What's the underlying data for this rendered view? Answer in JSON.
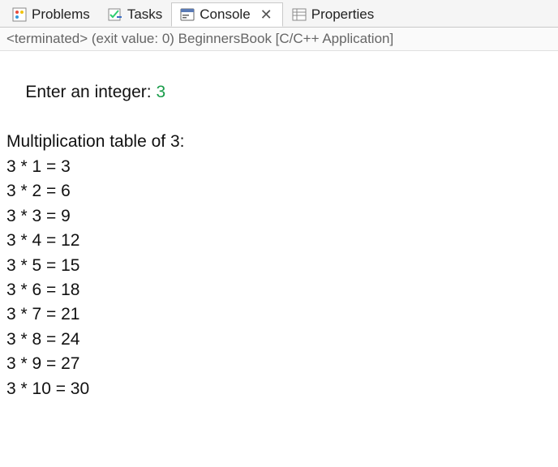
{
  "tabs": {
    "problems": {
      "label": "Problems"
    },
    "tasks": {
      "label": "Tasks"
    },
    "console": {
      "label": "Console"
    },
    "properties": {
      "label": "Properties"
    }
  },
  "status": "<terminated> (exit value: 0) BeginnersBook [C/C++ Application]",
  "output": {
    "prompt_label": "Enter an integer: ",
    "input_value": "3",
    "header": "Multiplication table of 3:",
    "lines": [
      "3 * 1 = 3",
      "3 * 2 = 6",
      "3 * 3 = 9",
      "3 * 4 = 12",
      "3 * 5 = 15",
      "3 * 6 = 18",
      "3 * 7 = 21",
      "3 * 8 = 24",
      "3 * 9 = 27",
      "3 * 10 = 30"
    ]
  }
}
